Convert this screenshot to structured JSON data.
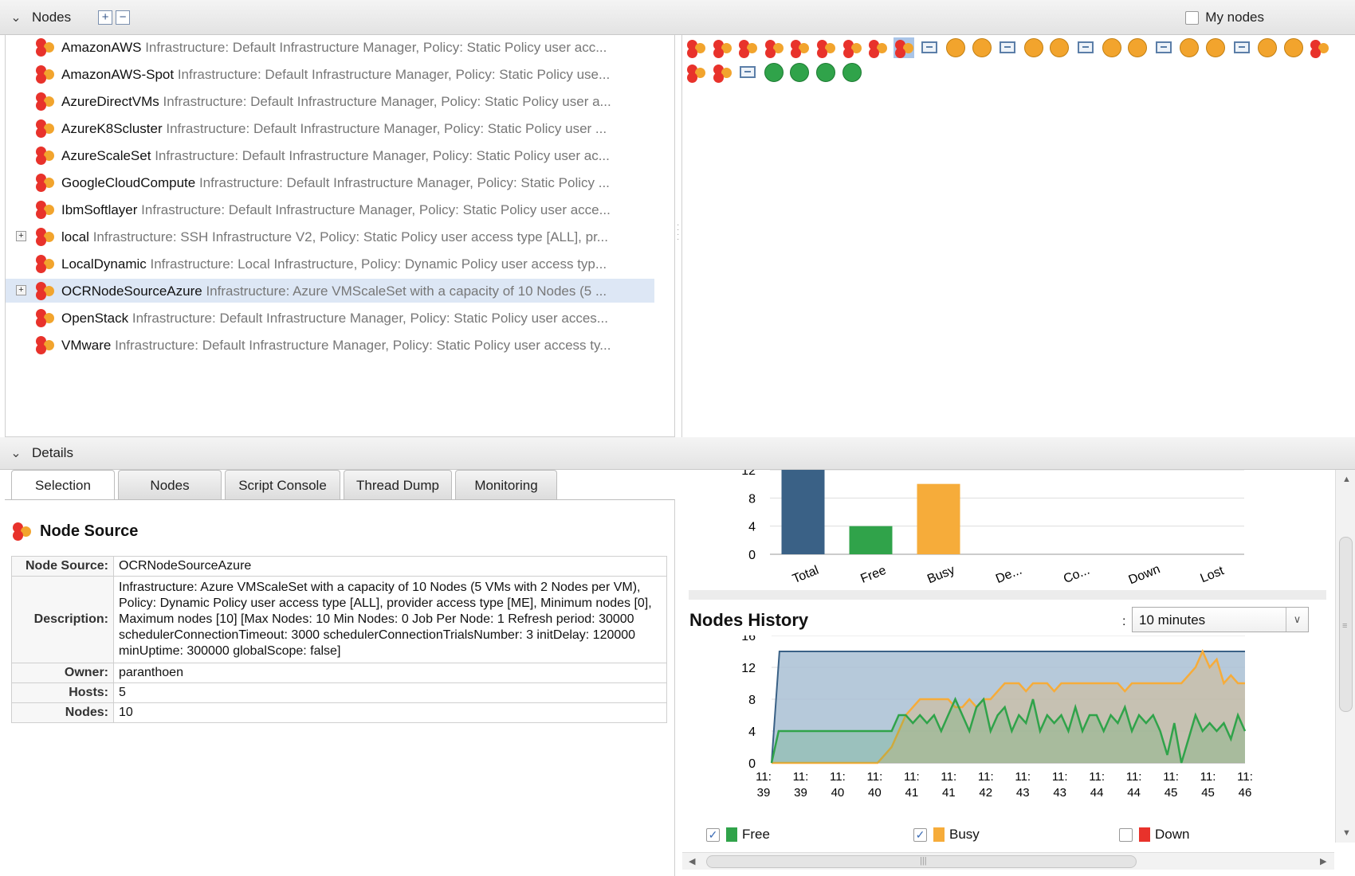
{
  "nodes_header": {
    "title": "Nodes",
    "expand_label": "+",
    "collapse_label": "−",
    "my_nodes": "My nodes"
  },
  "tree": [
    {
      "name": "AmazonAWS",
      "desc": "Infrastructure: Default Infrastructure Manager, Policy: Static Policy user acc...",
      "expandable": false
    },
    {
      "name": "AmazonAWS-Spot",
      "desc": "Infrastructure: Default Infrastructure Manager, Policy: Static Policy use...",
      "expandable": false
    },
    {
      "name": "AzureDirectVMs",
      "desc": "Infrastructure: Default Infrastructure Manager, Policy: Static Policy user a...",
      "expandable": false
    },
    {
      "name": "AzureK8Scluster",
      "desc": "Infrastructure: Default Infrastructure Manager, Policy: Static Policy user ...",
      "expandable": false
    },
    {
      "name": "AzureScaleSet",
      "desc": "Infrastructure: Default Infrastructure Manager, Policy: Static Policy user ac...",
      "expandable": false
    },
    {
      "name": "GoogleCloudCompute",
      "desc": "Infrastructure: Default Infrastructure Manager, Policy: Static Policy ...",
      "expandable": false
    },
    {
      "name": "IbmSoftlayer",
      "desc": "Infrastructure: Default Infrastructure Manager, Policy: Static Policy user acce...",
      "expandable": false
    },
    {
      "name": "local",
      "desc": "Infrastructure: SSH Infrastructure V2, Policy: Static Policy user access type [ALL], pr...",
      "expandable": true
    },
    {
      "name": "LocalDynamic",
      "desc": "Infrastructure: Local Infrastructure, Policy: Dynamic Policy user access typ...",
      "expandable": false
    },
    {
      "name": "OCRNodeSourceAzure",
      "desc": "Infrastructure: Azure VMScaleSet with a capacity of 10 Nodes (5 ...",
      "expandable": true,
      "selected": true
    },
    {
      "name": "OpenStack",
      "desc": "Infrastructure: Default Infrastructure Manager, Policy: Static Policy user acces...",
      "expandable": false
    },
    {
      "name": "VMware",
      "desc": "Infrastructure: Default Infrastructure Manager, Policy: Static Policy user access ty...",
      "expandable": false
    }
  ],
  "grid_row1": [
    "ns",
    "ns",
    "ns",
    "ns",
    "ns",
    "ns",
    "ns",
    "ns",
    "ns-sel",
    "host",
    "busy",
    "busy",
    "host",
    "busy",
    "busy",
    "host",
    "busy",
    "busy",
    "host",
    "busy",
    "busy",
    "host",
    "busy",
    "busy",
    "ns"
  ],
  "grid_row2": [
    "ns",
    "ns",
    "host",
    "free",
    "free",
    "free",
    "free"
  ],
  "details_header": {
    "title": "Details"
  },
  "tabs": [
    "Selection",
    "Nodes",
    "Script Console",
    "Thread Dump",
    "Monitoring"
  ],
  "node_source": {
    "heading": "Node Source",
    "rows": [
      {
        "key": "Node Source:",
        "value": "OCRNodeSourceAzure"
      },
      {
        "key": "Description:",
        "value": "Infrastructure: Azure VMScaleSet with a capacity of 10 Nodes (5 VMs with 2 Nodes per VM), Policy: Dynamic Policy user access type [ALL], provider access type [ME], Minimum nodes [0], Maximum nodes [10] [Max Nodes: 10 Min Nodes: 0 Job Per Node: 1 Refresh period: 30000 schedulerConnectionTimeout: 3000 schedulerConnectionTrialsNumber: 3 initDelay: 120000 minUptime: 300000 globalScope: false]"
      },
      {
        "key": "Owner:",
        "value": "paranthoen"
      },
      {
        "key": "Hosts:",
        "value": "5"
      },
      {
        "key": "Nodes:",
        "value": "10"
      }
    ]
  },
  "history": {
    "title": "Nodes History",
    "colon": ":",
    "range": "10 minutes"
  },
  "legend": [
    {
      "label": "Free",
      "color": "#30a34a",
      "checked": true
    },
    {
      "label": "Busy",
      "color": "#f6ac3a",
      "checked": true
    },
    {
      "label": "Down",
      "color": "#e8322b",
      "checked": false
    }
  ],
  "colors": {
    "ns_red": "#e8322b",
    "ns_orange": "#f2a42d",
    "bar_total": "#3a6186",
    "bar_free": "#30a34a",
    "bar_busy": "#f6ac3a",
    "area_total": "#a9bfd3"
  },
  "chart_data": [
    {
      "type": "bar",
      "categories": [
        "Total",
        "Free",
        "Busy",
        "De...",
        "Co...",
        "Down",
        "Lost"
      ],
      "values": [
        14,
        4,
        10,
        0,
        0,
        0,
        0
      ],
      "yticks": [
        "0",
        "4",
        "8",
        "12"
      ],
      "ylim": [
        0,
        12
      ]
    },
    {
      "type": "area",
      "title": "Nodes History",
      "x": [
        "11:39",
        "11:39",
        "11:40",
        "11:40",
        "11:41",
        "11:41",
        "11:42",
        "11:43",
        "11:43",
        "11:44",
        "11:44",
        "11:45",
        "11:45",
        "11:46"
      ],
      "yticks": [
        "0",
        "4",
        "8",
        "12",
        "16"
      ],
      "ylim": [
        0,
        16
      ],
      "series": [
        {
          "name": "Total",
          "values": [
            0,
            14,
            14,
            14,
            14,
            14,
            14,
            14,
            14,
            14,
            14,
            14,
            14,
            14,
            14,
            14,
            14,
            14,
            14,
            14,
            14,
            14,
            14,
            14,
            14,
            14,
            14,
            14,
            14,
            14,
            14,
            14,
            14,
            14,
            14,
            14,
            14,
            14,
            14,
            14,
            14,
            14,
            14,
            14,
            14,
            14,
            14,
            14,
            14,
            14,
            14,
            14,
            14,
            14,
            14,
            14,
            14,
            14,
            14,
            14,
            14
          ]
        },
        {
          "name": "Free",
          "values": [
            0,
            4,
            4,
            4,
            4,
            4,
            4,
            4,
            4,
            4,
            4,
            4,
            4,
            4,
            4,
            4,
            4,
            4,
            6,
            6,
            5,
            6,
            5,
            6,
            4,
            6,
            8,
            6,
            4,
            7,
            8,
            4,
            6,
            7,
            4,
            6,
            5,
            8,
            4,
            6,
            5,
            6,
            4,
            7,
            4,
            6,
            6,
            4,
            6,
            5,
            7,
            4,
            6,
            5,
            6,
            4,
            1,
            5,
            0,
            3,
            6,
            4,
            5,
            4,
            5,
            3,
            6,
            4
          ]
        },
        {
          "name": "Busy",
          "values": [
            0,
            0,
            0,
            0,
            0,
            0,
            0,
            0,
            0,
            0,
            0,
            0,
            0,
            0,
            0,
            0,
            1,
            2,
            4,
            6,
            7,
            8,
            8,
            8,
            8,
            8,
            7,
            7,
            8,
            7,
            8,
            8,
            9,
            10,
            10,
            10,
            9,
            10,
            10,
            10,
            9,
            10,
            10,
            10,
            10,
            10,
            10,
            10,
            10,
            10,
            9,
            10,
            10,
            10,
            10,
            10,
            10,
            10,
            10,
            11,
            12,
            14,
            12,
            13,
            10,
            11,
            10,
            10
          ]
        }
      ]
    }
  ]
}
